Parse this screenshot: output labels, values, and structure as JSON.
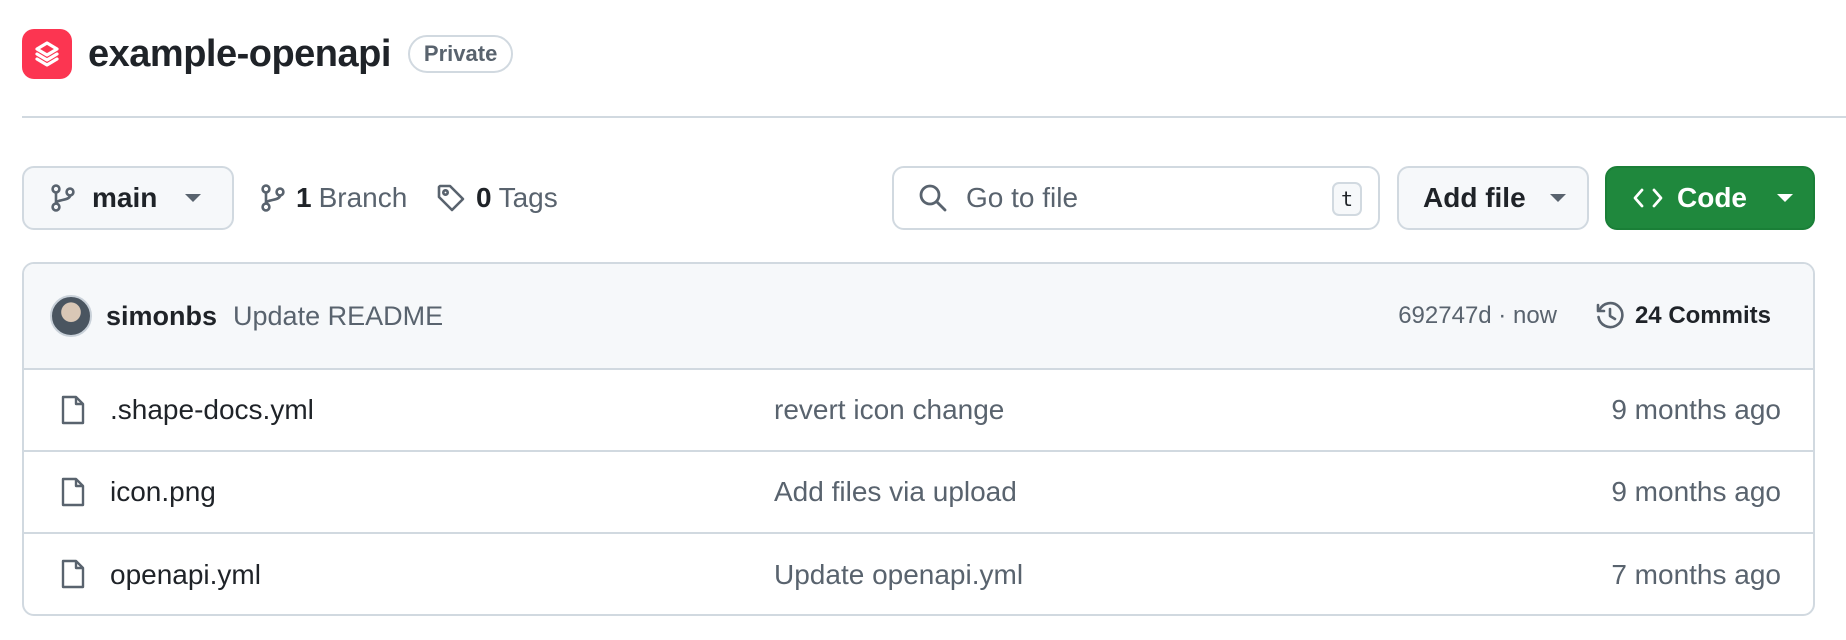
{
  "repo": {
    "name": "example-openapi",
    "visibility": "Private",
    "logo_color": "#fc3551"
  },
  "toolbar": {
    "branch": "main",
    "branches_count": "1",
    "branches_label": "Branch",
    "tags_count": "0",
    "tags_label": "Tags",
    "search_placeholder": "Go to file",
    "search_shortcut": "t",
    "add_file_label": "Add file",
    "code_label": "Code",
    "code_color": "#1f883d"
  },
  "latest_commit": {
    "author": "simonbs",
    "message": "Update README",
    "hash_time": "692747d · now",
    "commits_label": "24 Commits"
  },
  "files": [
    {
      "name": ".shape-docs.yml",
      "commit": "revert icon change",
      "date": "9 months ago",
      "icon": "file-icon"
    },
    {
      "name": "icon.png",
      "commit": "Add files via upload",
      "date": "9 months ago",
      "icon": "file-icon"
    },
    {
      "name": "openapi.yml",
      "commit": "Update openapi.yml",
      "date": "7 months ago",
      "icon": "file-icon"
    }
  ]
}
